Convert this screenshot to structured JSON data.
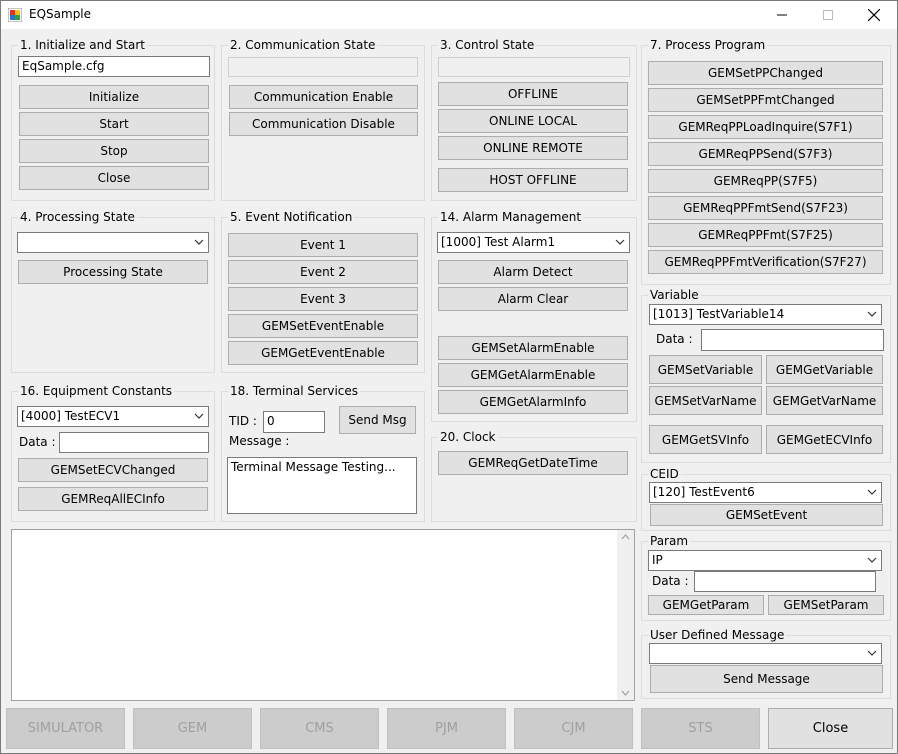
{
  "window": {
    "title": "EQSample"
  },
  "groups": {
    "init": {
      "label": "1. Initialize and Start",
      "config_file": "EqSample.cfg",
      "buttons": [
        "Initialize",
        "Start",
        "Stop",
        "Close"
      ]
    },
    "comm": {
      "label": "2. Communication State",
      "state_value": "",
      "buttons": [
        "Communication Enable",
        "Communication Disable"
      ]
    },
    "control": {
      "label": "3. Control State",
      "state_value": "",
      "buttons": [
        "OFFLINE",
        "ONLINE LOCAL",
        "ONLINE REMOTE",
        "HOST OFFLINE"
      ]
    },
    "processing": {
      "label": "4. Processing State",
      "selected": "",
      "button": "Processing State"
    },
    "event": {
      "label": "5. Event Notification",
      "buttons": [
        "Event 1",
        "Event 2",
        "Event 3",
        "GEMSetEventEnable",
        "GEMGetEventEnable"
      ]
    },
    "alarm": {
      "label": "14. Alarm Management",
      "selected": "[1000]  Test Alarm1",
      "buttons": [
        "Alarm Detect",
        "Alarm Clear",
        "GEMSetAlarmEnable",
        "GEMGetAlarmEnable",
        "GEMGetAlarmInfo"
      ]
    },
    "process_program": {
      "label": "7. Process Program",
      "buttons": [
        "GEMSetPPChanged",
        "GEMSetPPFmtChanged",
        "GEMReqPPLoadInquire(S7F1)",
        "GEMReqPPSend(S7F3)",
        "GEMReqPP(S7F5)",
        "GEMReqPPFmtSend(S7F23)",
        "GEMReqPPFmt(S7F25)",
        "GEMReqPPFmtVerification(S7F27)"
      ]
    },
    "variable": {
      "label": "Variable",
      "selected": "[1013]  TestVariable14",
      "data_label": "Data :",
      "data_value": "",
      "buttons": [
        "GEMSetVariable",
        "GEMGetVariable",
        "GEMSetVarName",
        "GEMGetVarName",
        "GEMGetSVInfo",
        "GEMGetECVInfo"
      ]
    },
    "ceid": {
      "label": "CEID",
      "selected": "[120]  TestEvent6",
      "button": "GEMSetEvent"
    },
    "param": {
      "label": "Param",
      "selected": "IP",
      "data_label": "Data :",
      "data_value": "",
      "buttons": [
        "GEMGetParam",
        "GEMSetParam"
      ]
    },
    "user_msg": {
      "label": "User Defined Message",
      "selected": "",
      "button": "Send Message"
    },
    "ecv": {
      "label": "16. Equipment Constants",
      "selected": "[4000]  TestECV1",
      "data_label": "Data :",
      "data_value": "",
      "buttons": [
        "GEMSetECVChanged",
        "GEMReqAllECInfo"
      ]
    },
    "terminal": {
      "label": "18. Terminal Services",
      "tid_label": "TID :",
      "tid_value": "0",
      "message_label": "Message :",
      "message_value": "Terminal Message Testing...",
      "send_button": "Send Msg"
    },
    "clock": {
      "label": "20. Clock",
      "button": "GEMReqGetDateTime"
    }
  },
  "log": {
    "text": ""
  },
  "bottom_buttons": [
    "SIMULATOR",
    "GEM",
    "CMS",
    "PJM",
    "CJM",
    "STS",
    "Close"
  ],
  "colors": {
    "window_bg": "#f0f0f0",
    "button_bg": "#e1e1e1",
    "disabled_text": "#a0a0a0"
  }
}
